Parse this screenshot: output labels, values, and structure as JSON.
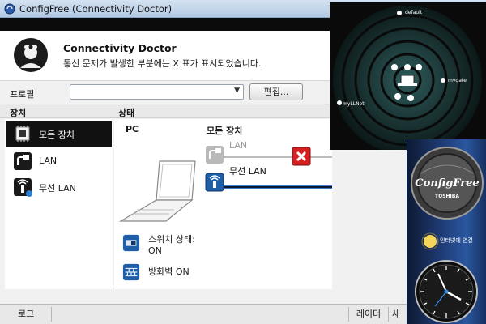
{
  "window": {
    "title": "ConfigFree (Connectivity Doctor)"
  },
  "header": {
    "title": "Connectivity Doctor",
    "subtitle": "통신 문제가 발생한 부분에는 X 표가 표시되었습니다."
  },
  "profile": {
    "label": "프로필",
    "selected": "",
    "edit_label": "편집..."
  },
  "columns": {
    "device": "장치",
    "status": "상태"
  },
  "devices": [
    {
      "label": "모든 장치",
      "icon": "chip-icon",
      "selected": true
    },
    {
      "label": "LAN",
      "icon": "lan-plug-icon",
      "selected": false
    },
    {
      "label": "무선 LAN",
      "icon": "wireless-icon",
      "selected": false
    }
  ],
  "status": {
    "pc_label": "PC",
    "all_devices_label": "모든 장치",
    "lan_label": "LAN",
    "lan_state": "error",
    "wlan_label": "무선 LAN",
    "switch_state_line1": "스위치 상태:",
    "switch_state_line2": "ON",
    "firewall_state": "방화벽 ON"
  },
  "statusbar": {
    "log_label": "로그",
    "radar_label": "레이더",
    "new_label": "새"
  },
  "radar": {
    "labels": [
      "default",
      "mygate",
      "myLLNet"
    ]
  },
  "gadgets": {
    "logo_text": "ConfigFree",
    "brand_text": "TOSHIBA",
    "weather_text": "인터넷에 연결"
  },
  "colors": {
    "selected_bg": "#111111",
    "error_red": "#d42020",
    "link_blue": "#3a78c8"
  }
}
